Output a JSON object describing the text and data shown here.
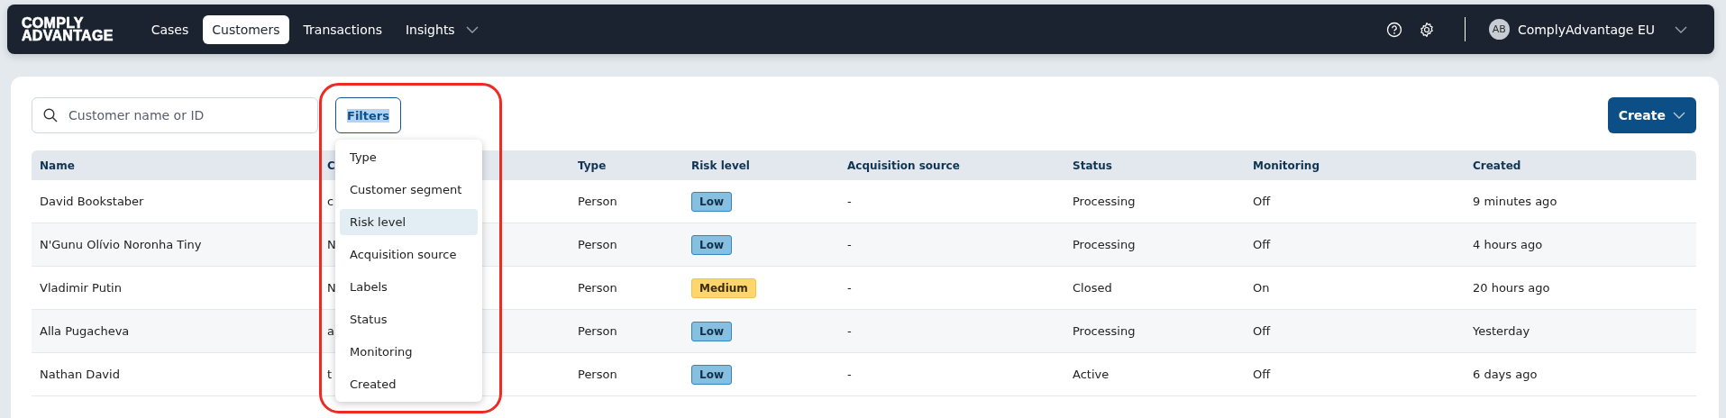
{
  "navbar": {
    "logo": [
      "COMPLY",
      "ADVANTAGE"
    ],
    "nav_items": [
      {
        "label": "Cases",
        "selected": false,
        "has_menu": false
      },
      {
        "label": "Customers",
        "selected": true,
        "has_menu": false
      },
      {
        "label": "Transactions",
        "selected": false,
        "has_menu": false
      },
      {
        "label": "Insights",
        "selected": false,
        "has_menu": true
      }
    ],
    "account": {
      "initials": "AB",
      "name": "ComplyAdvantage EU"
    }
  },
  "toolbar": {
    "search": {
      "placeholder": "Customer name or ID"
    },
    "filters": {
      "label": "Filters",
      "text_selected": true
    },
    "create": {
      "label": "Create"
    }
  },
  "table": {
    "columns": [
      "Name",
      "C",
      "Type",
      "Risk level",
      "Acquisition source",
      "Status",
      "Monitoring",
      "Created"
    ],
    "rows": [
      {
        "cells": [
          "David Bookstaber",
          "c",
          "Person",
          {
            "label": "Low",
            "kind": "low"
          },
          "-",
          "Processing",
          "Off",
          "9 minutes ago"
        ]
      },
      {
        "cells": [
          "N'Gunu Olívio Noronha Tiny",
          "N",
          "Person",
          {
            "label": "Low",
            "kind": "low"
          },
          "-",
          "Processing",
          "Off",
          "4 hours ago"
        ]
      },
      {
        "cells": [
          "Vladimir Putin",
          "N",
          "Person",
          {
            "label": "Medium",
            "kind": "medium"
          },
          "-",
          "Closed",
          "On",
          "20 hours ago"
        ]
      },
      {
        "cells": [
          "Alla Pugacheva",
          "a",
          "Person",
          {
            "label": "Low",
            "kind": "low"
          },
          "-",
          "Processing",
          "Off",
          "Yesterday"
        ]
      },
      {
        "cells": [
          "Nathan David",
          "t",
          "Person",
          {
            "label": "Low",
            "kind": "low"
          },
          "-",
          "Active",
          "Off",
          "6 days ago"
        ]
      }
    ]
  },
  "filter_menu": {
    "items": [
      {
        "label": "Type",
        "selected": false
      },
      {
        "label": "Customer segment",
        "selected": false
      },
      {
        "label": "Risk level",
        "selected": true
      },
      {
        "label": "Acquisition source",
        "selected": false
      },
      {
        "label": "Labels",
        "selected": false
      },
      {
        "label": "Status",
        "selected": false
      },
      {
        "label": "Monitoring",
        "selected": false
      },
      {
        "label": "Created",
        "selected": false
      }
    ]
  },
  "annotation": {
    "kind": "outline"
  }
}
